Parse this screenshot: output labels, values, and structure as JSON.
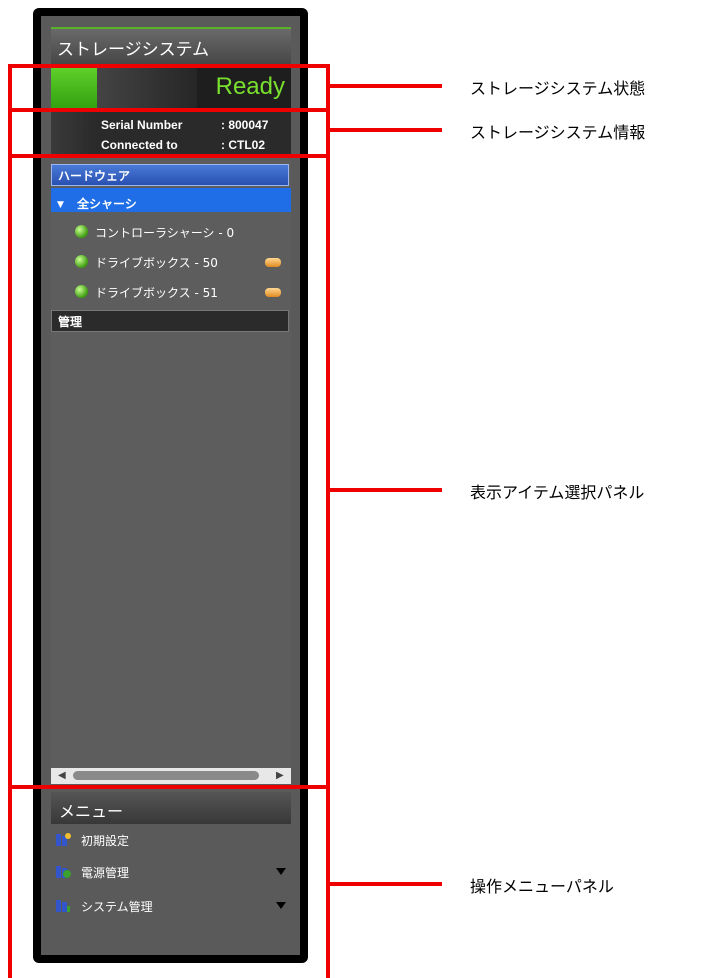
{
  "panel": {
    "title": "ストレージシステム",
    "status_text": "Ready",
    "serial_label": "Serial Number",
    "serial_value": ": 800047",
    "connected_label": "Connected to",
    "connected_value": ": CTL02"
  },
  "tree": {
    "section_hardware": "ハードウェア",
    "all_chassis": "全シャーシ",
    "items": [
      {
        "label": "コントローラシャーシ - 0",
        "status": "normal",
        "badge": false
      },
      {
        "label": "ドライブボックス - 50",
        "status": "normal",
        "badge": true
      },
      {
        "label": "ドライブボックス - 51",
        "status": "normal",
        "badge": true
      }
    ],
    "section_manage": "管理"
  },
  "menu": {
    "title": "メニュー",
    "items": [
      {
        "label": "初期設定",
        "icon": "settings-icon",
        "has_submenu": false
      },
      {
        "label": "電源管理",
        "icon": "power-icon",
        "has_submenu": true
      },
      {
        "label": "システム管理",
        "icon": "system-icon",
        "has_submenu": true
      }
    ]
  },
  "annotations": {
    "status": "ストレージシステム状態",
    "info": "ストレージシステム情報",
    "selection_panel": "表示アイテム選択パネル",
    "menu_panel": "操作メニューパネル"
  },
  "colors": {
    "annotation_red": "#ee0000",
    "ready_green": "#79e02e",
    "selected_blue": "#1f6ee8"
  }
}
